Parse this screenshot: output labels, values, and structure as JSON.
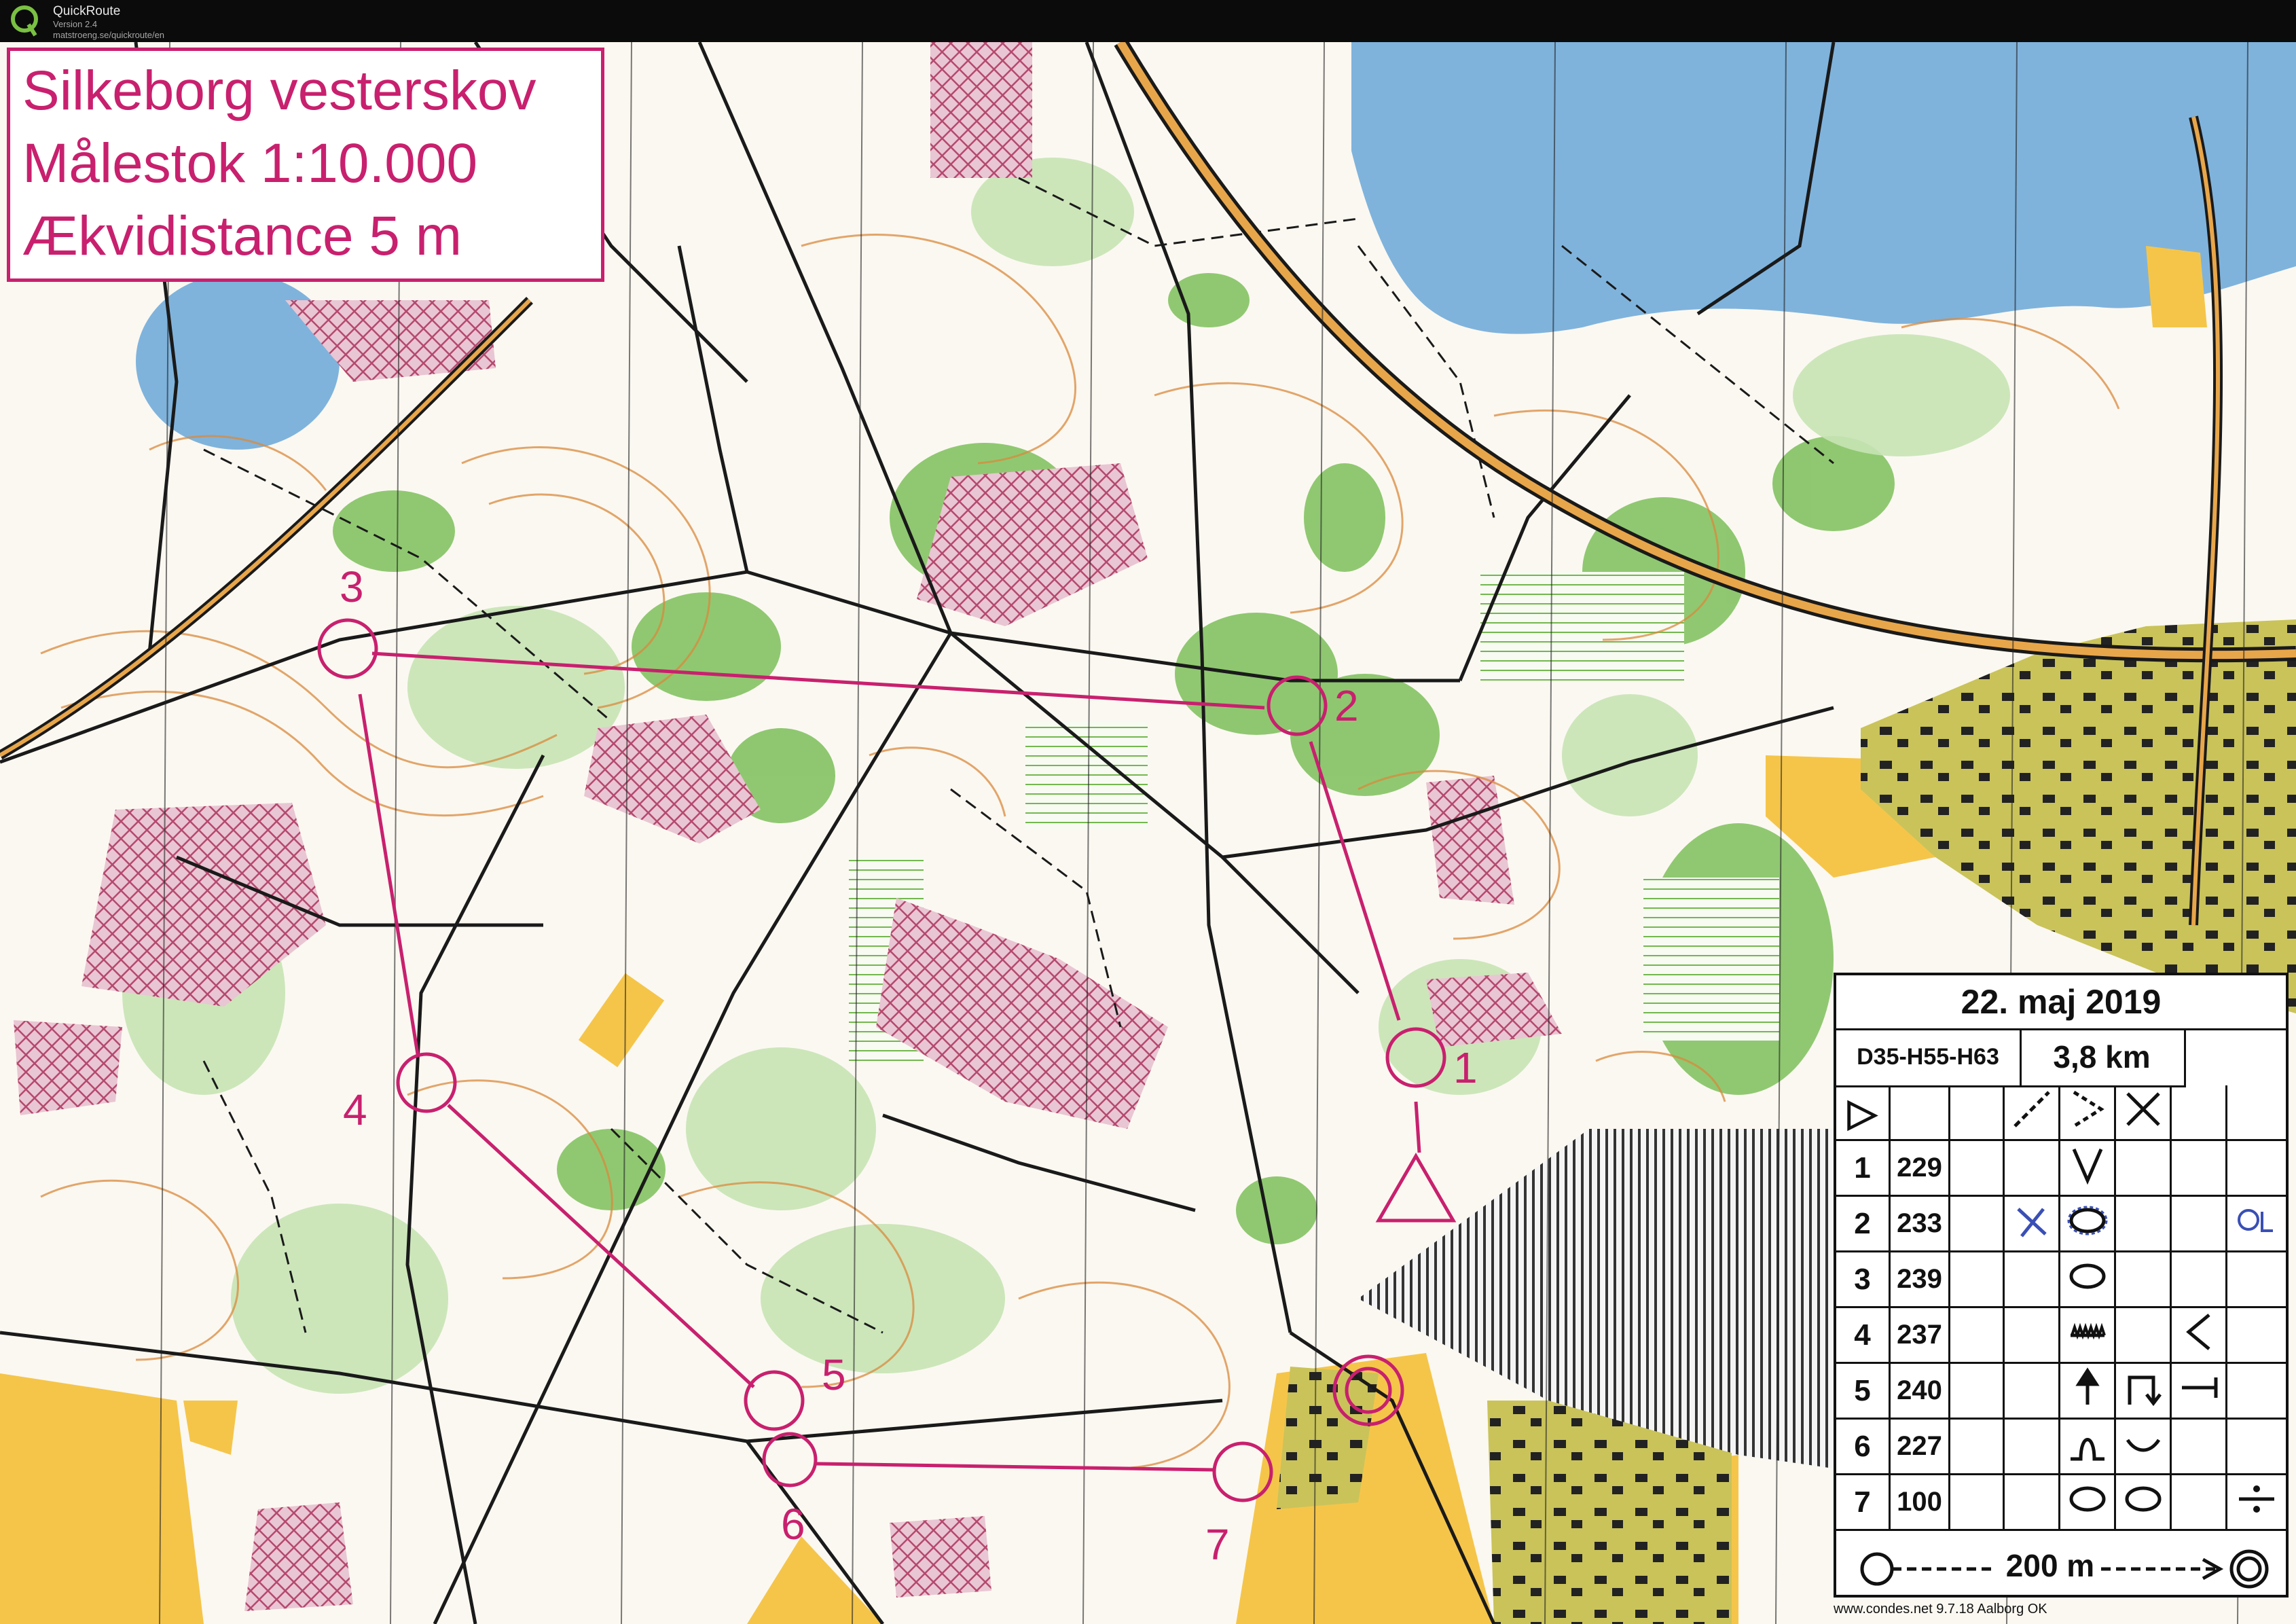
{
  "app": {
    "name": "QuickRoute",
    "version": "Version 2.4",
    "url": "matstroeng.se/quickroute/en",
    "logo_letter": "Q"
  },
  "map": {
    "title_lines": [
      "Silkeborg vesterskov",
      "Målestok 1:10.000",
      "Ækvidistance 5 m"
    ],
    "controls": [
      {
        "label": "1"
      },
      {
        "label": "2"
      },
      {
        "label": "3"
      },
      {
        "label": "4"
      },
      {
        "label": "5"
      },
      {
        "label": "6"
      },
      {
        "label": "7"
      }
    ],
    "colors": {
      "course": "#c8206e",
      "water": "#7fb3dc",
      "green": "#7cbf5a",
      "open": "#f5c54a",
      "urban": "#c9c35a",
      "forbidden": "#b5486e"
    }
  },
  "description_sheet": {
    "date": "22. maj 2019",
    "class": "D35-H55-H63",
    "length": "3,8 km",
    "start_symbol": "▷",
    "rows": [
      {
        "num": "1",
        "code": "229"
      },
      {
        "num": "2",
        "code": "233"
      },
      {
        "num": "3",
        "code": "239"
      },
      {
        "num": "4",
        "code": "237"
      },
      {
        "num": "5",
        "code": "240"
      },
      {
        "num": "6",
        "code": "227"
      },
      {
        "num": "7",
        "code": "100"
      }
    ],
    "finish_text": "200 m"
  },
  "footer": {
    "credit": "www.condes.net 9.7.18 Aalborg OK"
  }
}
